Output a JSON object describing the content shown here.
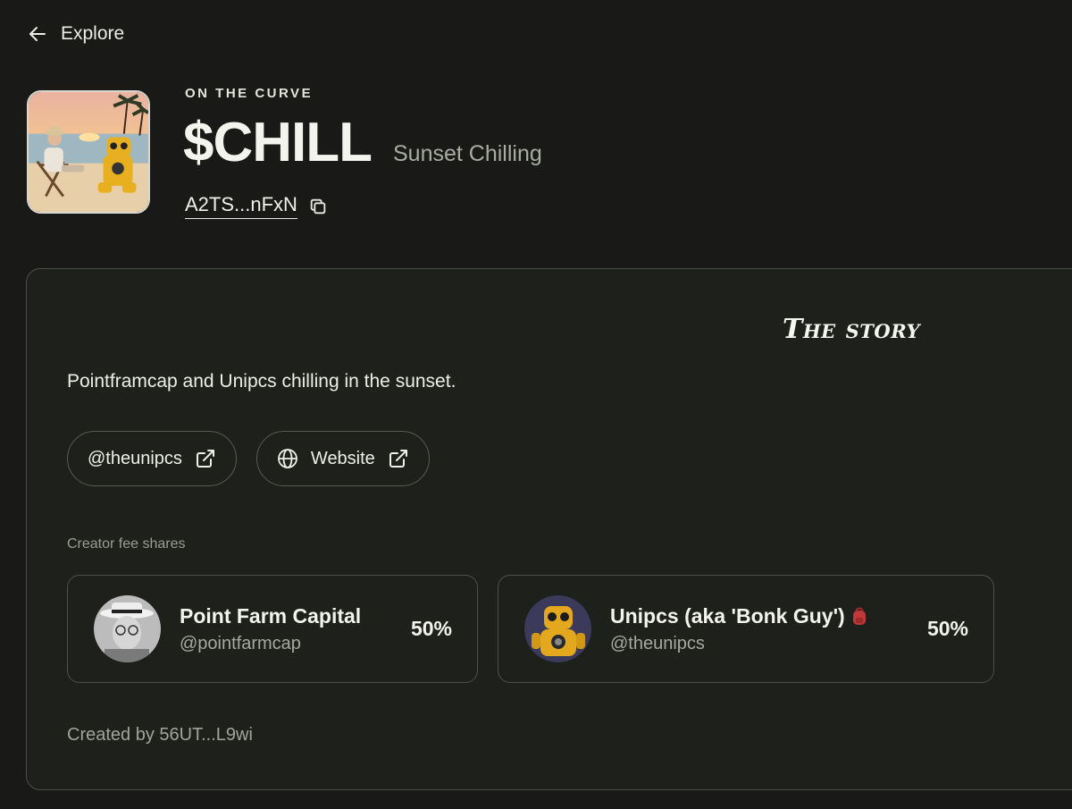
{
  "nav": {
    "back_label": "Explore"
  },
  "token": {
    "status": "ON THE CURVE",
    "ticker": "$CHILL",
    "name": "Sunset Chilling",
    "address": "A2TS...nFxN"
  },
  "story": {
    "heading": "The story",
    "text": "Pointframcap and Unipcs chilling in the sunset.",
    "links": [
      {
        "label": "@theunipcs",
        "icon": "external-link-icon"
      },
      {
        "label": "Website",
        "icon": "globe-icon"
      }
    ]
  },
  "fees": {
    "label": "Creator fee shares",
    "shares": [
      {
        "name": "Point Farm Capital",
        "handle": "@pointfarmcap",
        "percent": "50%"
      },
      {
        "name": "Unipcs (aka 'Bonk Guy')",
        "handle": "@theunipcs",
        "percent": "50%"
      }
    ]
  },
  "created_by": "Created by 56UT...L9wi",
  "colors": {
    "background": "#191a17",
    "panel": "#1e201c",
    "border": "#4a4d45",
    "text": "#f2f2ec",
    "muted": "#a6a99f"
  }
}
